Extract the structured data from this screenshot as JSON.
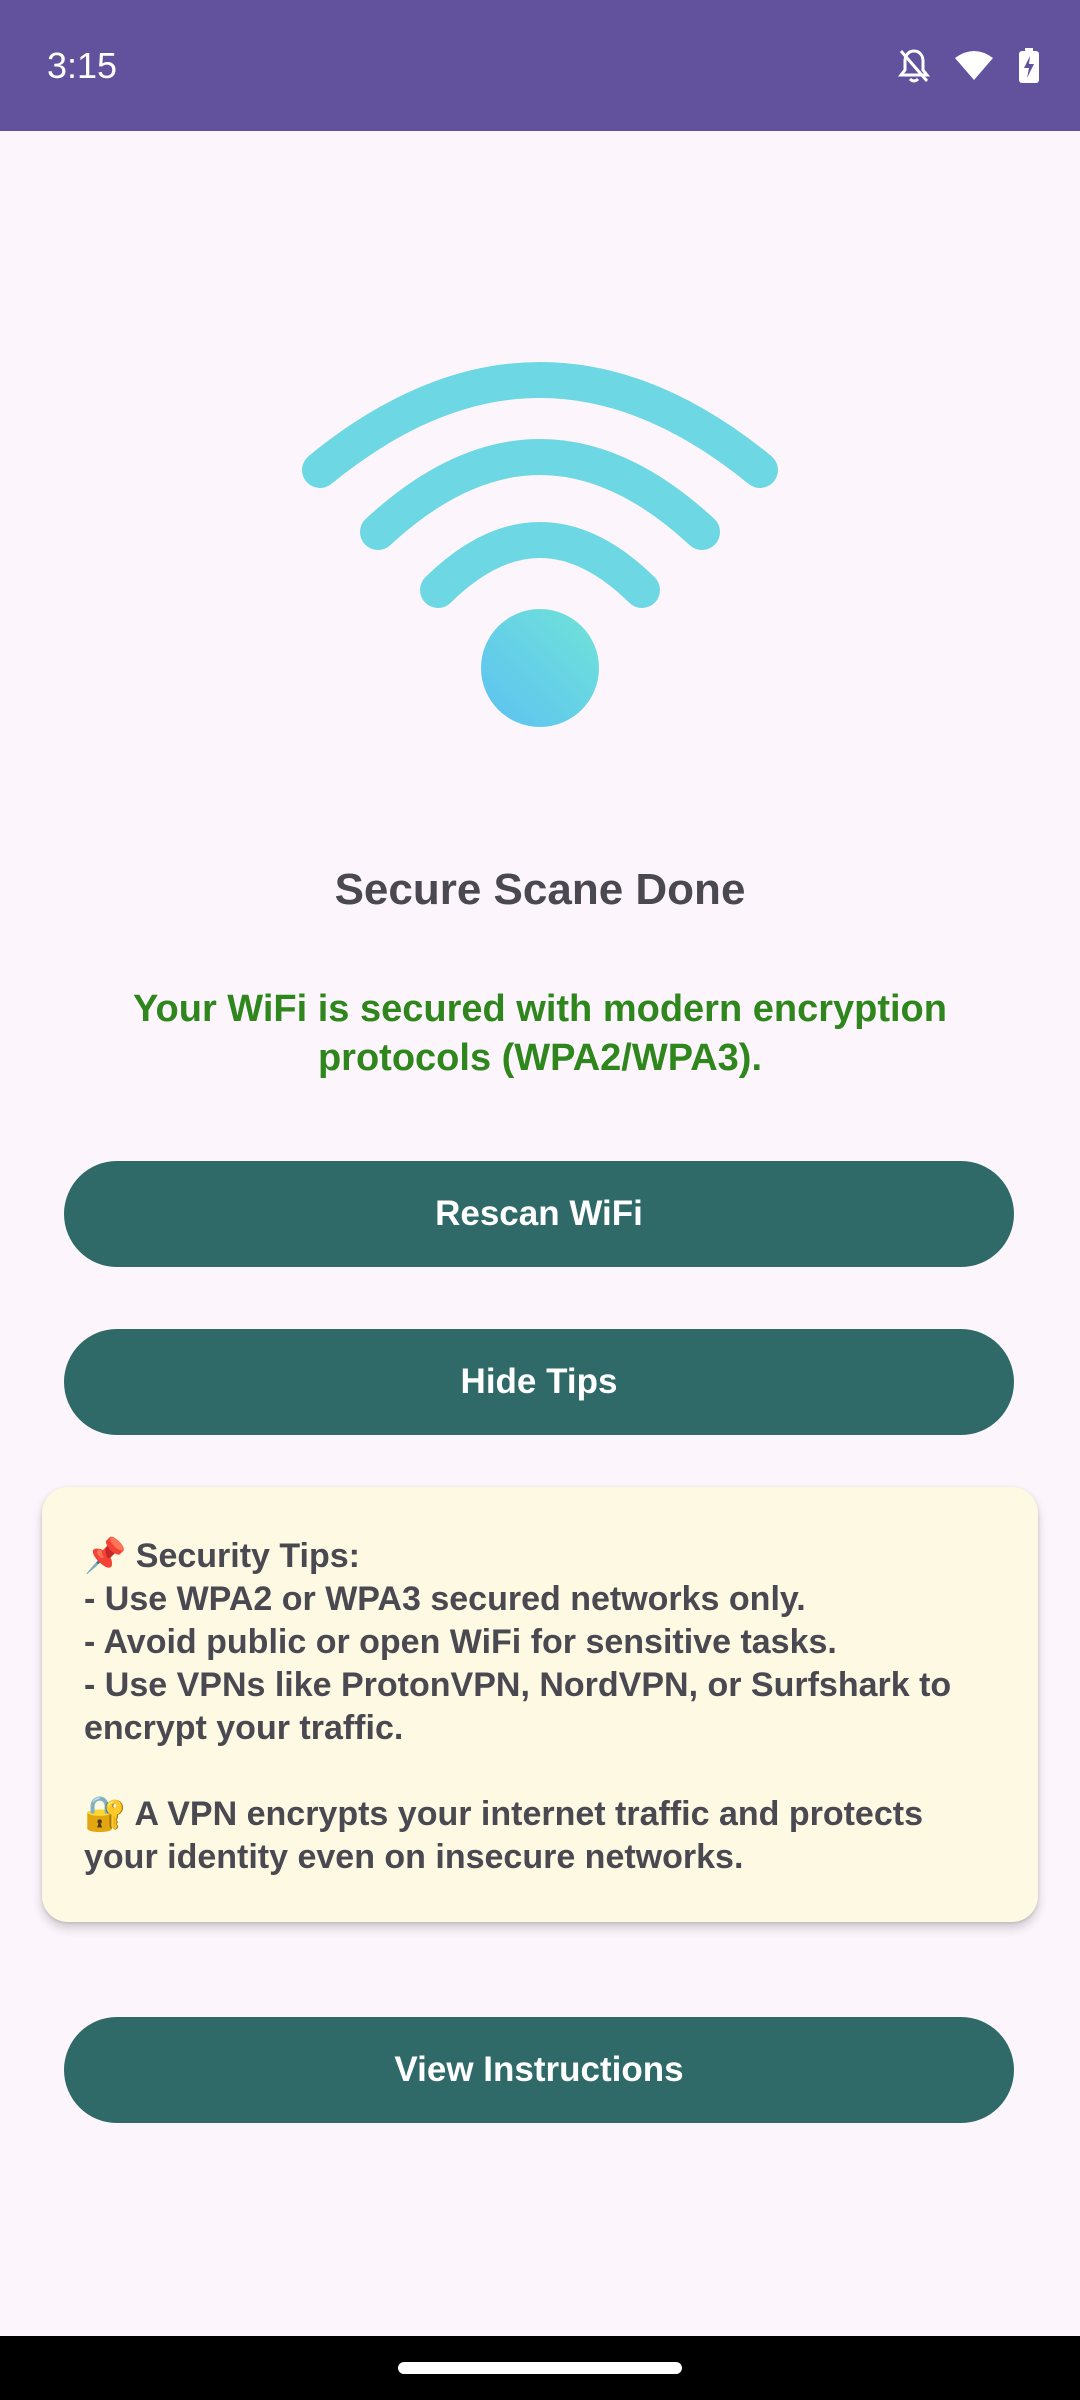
{
  "status_bar": {
    "time": "3:15",
    "icons": [
      "notifications-off-icon",
      "wifi-icon",
      "battery-charging-icon"
    ],
    "background": "#62519d"
  },
  "illustration": {
    "icon": "wifi-signal-icon",
    "arc_color": "#6dd8e3",
    "dot_gradient": [
      "#71e3d8",
      "#5cc1f2"
    ]
  },
  "scan": {
    "title": "Secure Scane Done",
    "message": "Your WiFi is secured with modern encryption protocols (WPA2/WPA3).",
    "message_color": "#2e861c"
  },
  "buttons": {
    "rescan_label": "Rescan WiFi",
    "hide_tips_label": "Hide Tips",
    "instructions_label": "View Instructions",
    "color": "#2f6a68"
  },
  "tips": {
    "heading": "📌 Security Tips:",
    "items": [
      "- Use WPA2 or WPA3 secured networks only.",
      "- Avoid public or open WiFi for sensitive tasks.",
      "- Use VPNs like ProtonVPN, NordVPN, or Surfshark to encrypt your traffic."
    ],
    "vpn_note": "🔐 A VPN encrypts your internet traffic and protects your identity even on insecure networks.",
    "card_color": "#fef9e3"
  }
}
